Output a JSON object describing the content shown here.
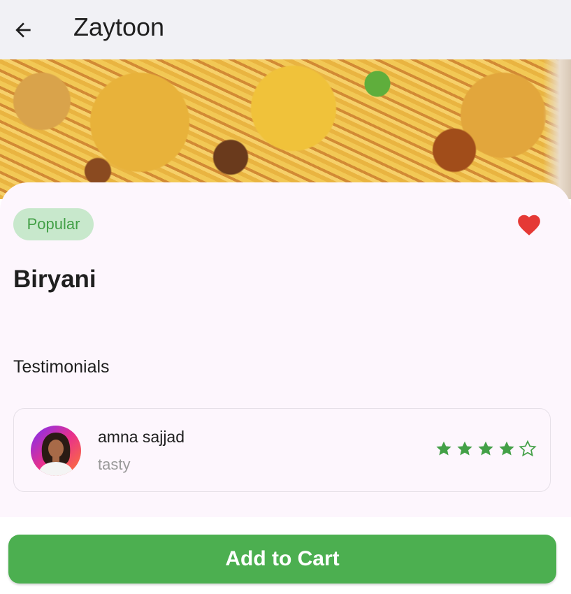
{
  "app_bar": {
    "title": "Zaytoon",
    "back_icon": "arrow-left-icon"
  },
  "hero_image": {
    "subject": "biryani-dish-photo"
  },
  "item": {
    "badge": "Popular",
    "name": "Biryani",
    "favorite_icon": "heart-icon",
    "favorite_color": "#e53935"
  },
  "testimonials": {
    "title": "Testimonials",
    "reviews": [
      {
        "name": "amna sajjad",
        "comment": "tasty",
        "rating": 4,
        "max_rating": 5
      }
    ]
  },
  "cta": {
    "label": "Add to Cart"
  },
  "colors": {
    "accent": "#4caf50",
    "badge_bg": "#c8e8cc",
    "badge_text": "#43a047",
    "star": "#43a047",
    "sheet_bg": "#fdf6fd"
  }
}
